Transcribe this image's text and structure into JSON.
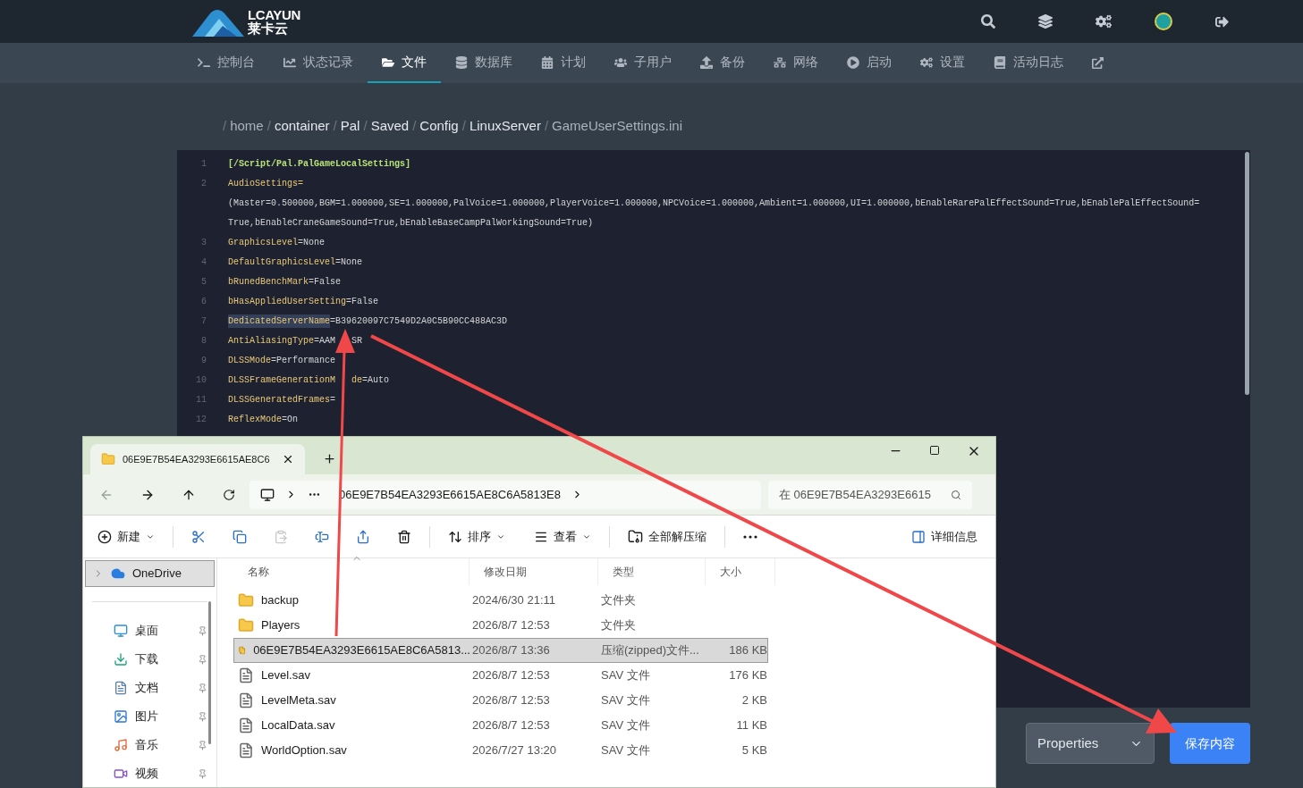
{
  "logo": {
    "text": "LCAYUN",
    "subtitle": "莱卡云"
  },
  "nav": [
    {
      "label": "控制台",
      "selected": false
    },
    {
      "label": "状态记录",
      "selected": false
    },
    {
      "label": "文件",
      "selected": true
    },
    {
      "label": "数据库",
      "selected": false
    },
    {
      "label": "计划",
      "selected": false
    },
    {
      "label": "子用户",
      "selected": false
    },
    {
      "label": "备份",
      "selected": false
    },
    {
      "label": "网络",
      "selected": false
    },
    {
      "label": "启动",
      "selected": false
    },
    {
      "label": "设置",
      "selected": false
    },
    {
      "label": "活动日志",
      "selected": false
    }
  ],
  "breadcrumb": [
    {
      "separator": "/",
      "label": "home"
    },
    {
      "separator": "/",
      "label": "container"
    },
    {
      "separator": "/",
      "label": "Pal"
    },
    {
      "separator": "/",
      "label": "Saved"
    },
    {
      "separator": "/",
      "label": "Config"
    },
    {
      "separator": "/",
      "label": "LinuxServer"
    },
    {
      "separator": "/",
      "label": "GameUserSettings.ini"
    }
  ],
  "editor": {
    "rows": [
      {
        "number": "1",
        "selected": false,
        "parts": [
          {
            "kind": "section",
            "text": "[/Script/Pal.PalGameLocalSettings]"
          }
        ]
      },
      {
        "number": "2",
        "selected": false,
        "parts": [
          {
            "kind": "key",
            "text": "AudioSettings="
          }
        ]
      },
      {
        "selected": false,
        "parts": [
          {
            "kind": "value",
            "text": "(Master=0.500000,BGM=1.000000,SE=1.000000,PalVoice=1.000000,PlayerVoice=1.000000,NPCVoice=1.000000,Ambient=1.000000,UI=1.000000,bEnableRarePalEffectSound=True,bEnablePalEffectSound="
          }
        ]
      },
      {
        "selected": false,
        "parts": [
          {
            "kind": "value",
            "text": "True,bEnableCraneGameSound=True,bEnableBaseCampPalWorkingSound=True)"
          }
        ]
      },
      {
        "number": "3",
        "selected": false,
        "parts": [
          {
            "kind": "key",
            "text": "GraphicsLevel"
          },
          {
            "kind": "value",
            "text": "=None"
          }
        ]
      },
      {
        "number": "4",
        "selected": false,
        "parts": [
          {
            "kind": "key",
            "text": "DefaultGraphicsLevel"
          },
          {
            "kind": "value",
            "text": "=None"
          }
        ]
      },
      {
        "number": "5",
        "selected": false,
        "parts": [
          {
            "kind": "key",
            "text": "bRunedBenchMark"
          },
          {
            "kind": "value",
            "text": "=False"
          }
        ]
      },
      {
        "number": "6",
        "selected": false,
        "parts": [
          {
            "kind": "key",
            "text": "bHasAppliedUserSetting"
          },
          {
            "kind": "value",
            "text": "=False"
          }
        ]
      },
      {
        "number": "7",
        "selected": true,
        "parts": [
          {
            "kind": "key",
            "text": "DedicatedServerName"
          },
          {
            "kind": "value",
            "text": "=B39620097C7549D2A0C5B90CC488AC3D"
          }
        ]
      },
      {
        "number": "8",
        "selected": false,
        "parts": [
          {
            "kind": "key",
            "text": "AntiAliasingType"
          },
          {
            "kind": "value",
            "text": "=AAM"
          },
          {
            "kind": "gap"
          },
          {
            "kind": "value",
            "text": "SR"
          }
        ]
      },
      {
        "number": "9",
        "selected": false,
        "parts": [
          {
            "kind": "key",
            "text": "DLSSMode"
          },
          {
            "kind": "value",
            "text": "=Performance"
          }
        ]
      },
      {
        "number": "10",
        "selected": false,
        "parts": [
          {
            "kind": "key",
            "text": "DLSSFrameGenerationM"
          },
          {
            "kind": "gap"
          },
          {
            "kind": "key",
            "text": "de"
          },
          {
            "kind": "value",
            "text": "=Auto"
          }
        ]
      },
      {
        "number": "11",
        "selected": false,
        "parts": [
          {
            "kind": "key",
            "text": "DLSSGeneratedFrames"
          },
          {
            "kind": "value",
            "text": "="
          }
        ]
      },
      {
        "number": "12",
        "selected": false,
        "parts": [
          {
            "kind": "key",
            "text": "ReflexMode"
          },
          {
            "kind": "value",
            "text": "=On"
          }
        ]
      }
    ]
  },
  "properties_select": {
    "value": "Properties"
  },
  "save_button": "保存内容",
  "explorer": {
    "tab_title": "06E9E7B54EA3293E6615AE8C6",
    "address": "06E9E7B54EA3293E6615AE8C6A5813E8",
    "search_placeholder": "在 06E9E7B54EA3293E6615",
    "toolbar": {
      "new": "新建",
      "sort": "排序",
      "view": "查看",
      "extract": "全部解压缩",
      "details": "详细信息",
      "paste_disabled": true
    },
    "sidebar": [
      {
        "label": "OneDrive",
        "selected": true
      },
      {
        "label": "桌面",
        "selected": false
      },
      {
        "label": "下载",
        "selected": false
      },
      {
        "label": "文档",
        "selected": false
      },
      {
        "label": "图片",
        "selected": false
      },
      {
        "label": "音乐",
        "selected": false
      },
      {
        "label": "视频",
        "selected": false
      }
    ],
    "columns": [
      "名称",
      "修改日期",
      "类型",
      "大小"
    ],
    "files": [
      {
        "kind": "folder",
        "name": "backup",
        "date": "2024/6/30 21:11",
        "type": "文件夹",
        "selected": false
      },
      {
        "kind": "folder",
        "name": "Players",
        "date": "2026/8/7 12:53",
        "type": "文件夹",
        "selected": false
      },
      {
        "kind": "zip",
        "name": "06E9E7B54EA3293E6615AE8C6A5813...",
        "date": "2026/8/7 13:36",
        "type": "压缩(zipped)文件...",
        "size": "186 KB",
        "selected": true
      },
      {
        "kind": "file",
        "name": "Level.sav",
        "date": "2026/8/7 12:53",
        "type": "SAV 文件",
        "size": "176 KB",
        "selected": false
      },
      {
        "kind": "file",
        "name": "LevelMeta.sav",
        "date": "2026/8/7 12:53",
        "type": "SAV 文件",
        "size": "2 KB",
        "selected": false
      },
      {
        "kind": "file",
        "name": "LocalData.sav",
        "date": "2026/8/7 12:53",
        "type": "SAV 文件",
        "size": "11 KB",
        "selected": false
      },
      {
        "kind": "file",
        "name": "WorldOption.sav",
        "date": "2026/7/27 13:20",
        "type": "SAV 文件",
        "size": "5 KB",
        "selected": false
      }
    ]
  }
}
